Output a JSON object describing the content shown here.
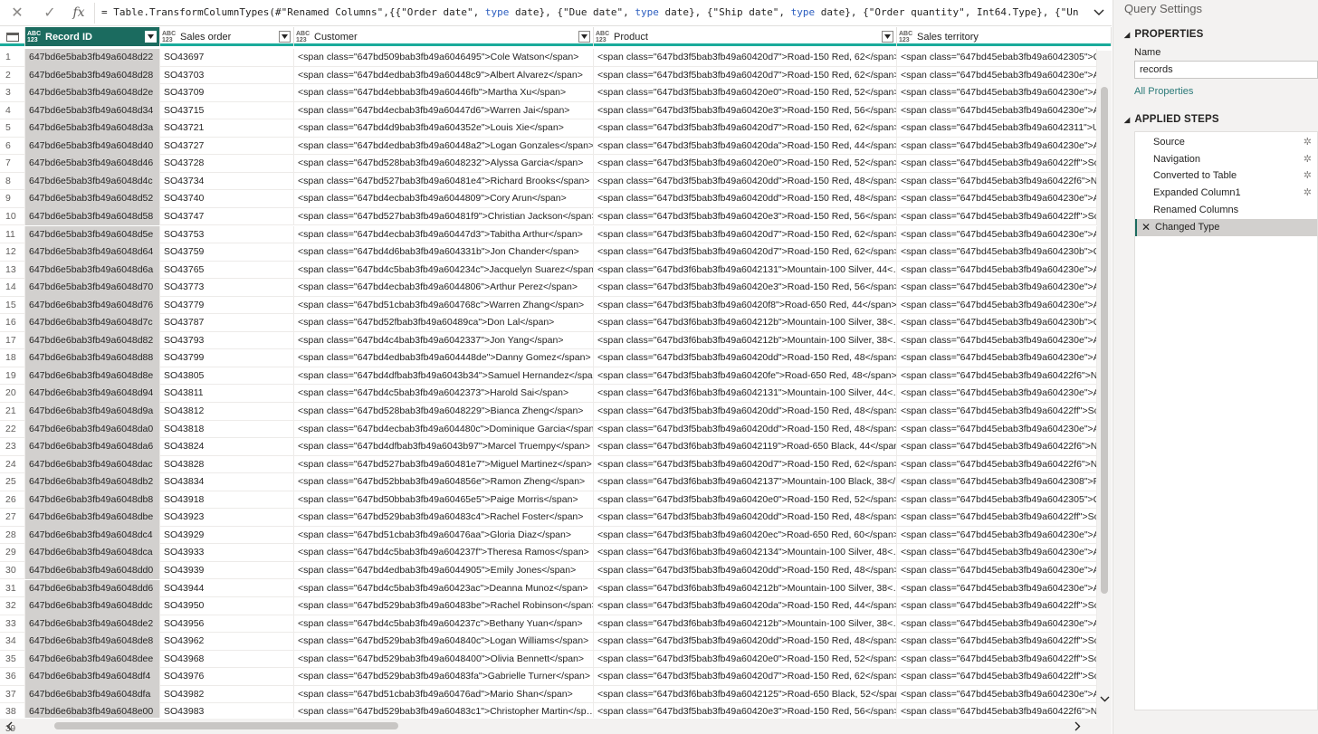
{
  "formula_bar": {
    "cancel_icon": "close-icon",
    "commit_icon": "check-icon",
    "fx_label": "fx",
    "formula_parts": [
      {
        "t": "= Table.TransformColumnTypes(#\"Renamed Columns\",{{\"Order date\", ",
        "kw": false
      },
      {
        "t": "type",
        "kw": true
      },
      {
        "t": " date}, {\"Due date\", ",
        "kw": false
      },
      {
        "t": "type",
        "kw": true
      },
      {
        "t": " date}, {\"Ship date\", ",
        "kw": false
      },
      {
        "t": "type",
        "kw": true
      },
      {
        "t": " date}, {\"Order quantity\", Int64.Type}, {\"Unit price $\",",
        "kw": false
      }
    ]
  },
  "grid": {
    "columns": [
      {
        "type_top": "ABC",
        "type_bottom": "123",
        "label": "Record ID",
        "selected": true
      },
      {
        "type_top": "ABC",
        "type_bottom": "123",
        "label": "Sales order",
        "selected": false
      },
      {
        "type_top": "ABC",
        "type_bottom": "123",
        "label": "Customer",
        "selected": false
      },
      {
        "type_top": "ABC",
        "type_bottom": "123",
        "label": "Product",
        "selected": false
      },
      {
        "type_top": "ABC",
        "type_bottom": "123",
        "label": "Sales territory",
        "selected": false
      }
    ],
    "rows": [
      [
        "1",
        "647bd6e5bab3fb49a6048d22",
        "SO43697",
        "<span class=\"647bd509bab3fb49a6046495\">Cole Watson</span>",
        "<span class=\"647bd3f5bab3fb49a60420d7\">Road-150 Red, 62</span>",
        "<span class=\"647bd45ebab3fb49a6042305\">Ca"
      ],
      [
        "2",
        "647bd6e5bab3fb49a6048d28",
        "SO43703",
        "<span class=\"647bd4edbab3fb49a60448c9\">Albert Alvarez</span>",
        "<span class=\"647bd3f5bab3fb49a60420d7\">Road-150 Red, 62</span>",
        "<span class=\"647bd45ebab3fb49a604230e\">Au"
      ],
      [
        "3",
        "647bd6e5bab3fb49a6048d2e",
        "SO43709",
        "<span class=\"647bd4ebbab3fb49a60446fb\">Martha Xu</span>",
        "<span class=\"647bd3f5bab3fb49a60420e0\">Road-150 Red, 52</span>",
        "<span class=\"647bd45ebab3fb49a604230e\">Au"
      ],
      [
        "4",
        "647bd6e5bab3fb49a6048d34",
        "SO43715",
        "<span class=\"647bd4ecbab3fb49a60447d6\">Warren Jai</span>",
        "<span class=\"647bd3f5bab3fb49a60420e3\">Road-150 Red, 56</span>",
        "<span class=\"647bd45ebab3fb49a604230e\">Au"
      ],
      [
        "5",
        "647bd6e5bab3fb49a6048d3a",
        "SO43721",
        "<span class=\"647bd4d9bab3fb49a604352e\">Louis Xie</span>",
        "<span class=\"647bd3f5bab3fb49a60420d7\">Road-150 Red, 62</span>",
        "<span class=\"647bd45ebab3fb49a6042311\">Ur"
      ],
      [
        "6",
        "647bd6e5bab3fb49a6048d40",
        "SO43727",
        "<span class=\"647bd4edbab3fb49a60448a2\">Logan Gonzales</span>",
        "<span class=\"647bd3f5bab3fb49a60420da\">Road-150 Red, 44</span>",
        "<span class=\"647bd45ebab3fb49a604230e\">Au"
      ],
      [
        "7",
        "647bd6e5bab3fb49a6048d46",
        "SO43728",
        "<span class=\"647bd528bab3fb49a6048232\">Alyssa Garcia</span>",
        "<span class=\"647bd3f5bab3fb49a60420e0\">Road-150 Red, 52</span>",
        "<span class=\"647bd45ebab3fb49a60422ff\">Sou"
      ],
      [
        "8",
        "647bd6e5bab3fb49a6048d4c",
        "SO43734",
        "<span class=\"647bd527bab3fb49a60481e4\">Richard Brooks</span>",
        "<span class=\"647bd3f5bab3fb49a60420dd\">Road-150 Red, 48</span>",
        "<span class=\"647bd45ebab3fb49a60422f6\">No"
      ],
      [
        "9",
        "647bd6e5bab3fb49a6048d52",
        "SO43740",
        "<span class=\"647bd4ecbab3fb49a6044809\">Cory Arun</span>",
        "<span class=\"647bd3f5bab3fb49a60420dd\">Road-150 Red, 48</span>",
        "<span class=\"647bd45ebab3fb49a604230e\">Au"
      ],
      [
        "10",
        "647bd6e5bab3fb49a6048d58",
        "SO43747",
        "<span class=\"647bd527bab3fb49a60481f9\">Christian Jackson</span>",
        "<span class=\"647bd3f5bab3fb49a60420e3\">Road-150 Red, 56</span>",
        "<span class=\"647bd45ebab3fb49a60422ff\">Sou"
      ],
      [
        "11",
        "647bd6e5bab3fb49a6048d5e",
        "SO43753",
        "<span class=\"647bd4ecbab3fb49a60447d3\">Tabitha Arthur</span>",
        "<span class=\"647bd3f5bab3fb49a60420d7\">Road-150 Red, 62</span>",
        "<span class=\"647bd45ebab3fb49a604230e\">Au"
      ],
      [
        "12",
        "647bd6e5bab3fb49a6048d64",
        "SO43759",
        "<span class=\"647bd4d6bab3fb49a604331b\">Jon Chander</span>",
        "<span class=\"647bd3f5bab3fb49a60420d7\">Road-150 Red, 62</span>",
        "<span class=\"647bd45ebab3fb49a604230b\">Ge"
      ],
      [
        "13",
        "647bd6e5bab3fb49a6048d6a",
        "SO43765",
        "<span class=\"647bd4c5bab3fb49a604234c\">Jacquelyn Suarez</span>",
        "<span class=\"647bd3f6bab3fb49a6042131\">Mountain-100 Silver, 44<…",
        "<span class=\"647bd45ebab3fb49a604230e\">Au"
      ],
      [
        "14",
        "647bd6e5bab3fb49a6048d70",
        "SO43773",
        "<span class=\"647bd4ecbab3fb49a6044806\">Arthur Perez</span>",
        "<span class=\"647bd3f5bab3fb49a60420e3\">Road-150 Red, 56</span>",
        "<span class=\"647bd45ebab3fb49a604230e\">Au"
      ],
      [
        "15",
        "647bd6e6bab3fb49a6048d76",
        "SO43779",
        "<span class=\"647bd51cbab3fb49a604768c\">Warren Zhang</span>",
        "<span class=\"647bd3f5bab3fb49a60420f8\">Road-650 Red, 44</span>",
        "<span class=\"647bd45ebab3fb49a604230e\">Au"
      ],
      [
        "16",
        "647bd6e6bab3fb49a6048d7c",
        "SO43787",
        "<span class=\"647bd52fbab3fb49a60489ca\">Don Lal</span>",
        "<span class=\"647bd3f6bab3fb49a604212b\">Mountain-100 Silver, 38<…",
        "<span class=\"647bd45ebab3fb49a604230b\">Ge"
      ],
      [
        "17",
        "647bd6e6bab3fb49a6048d82",
        "SO43793",
        "<span class=\"647bd4c4bab3fb49a6042337\">Jon Yang</span>",
        "<span class=\"647bd3f6bab3fb49a604212b\">Mountain-100 Silver, 38<…",
        "<span class=\"647bd45ebab3fb49a604230e\">Au"
      ],
      [
        "18",
        "647bd6e6bab3fb49a6048d88",
        "SO43799",
        "<span class=\"647bd4edbab3fb49a604448de\">Danny Gomez</span>",
        "<span class=\"647bd3f5bab3fb49a60420dd\">Road-150 Red, 48</span>",
        "<span class=\"647bd45ebab3fb49a604230e\">Au"
      ],
      [
        "19",
        "647bd6e6bab3fb49a6048d8e",
        "SO43805",
        "<span class=\"647bd4dfbab3fb49a6043b34\">Samuel Hernandez</spa…",
        "<span class=\"647bd3f5bab3fb49a60420fe\">Road-650 Red, 48</span>",
        "<span class=\"647bd45ebab3fb49a60422f6\">No"
      ],
      [
        "20",
        "647bd6e6bab3fb49a6048d94",
        "SO43811",
        "<span class=\"647bd4c5bab3fb49a6042373\">Harold Sai</span>",
        "<span class=\"647bd3f6bab3fb49a6042131\">Mountain-100 Silver, 44<…",
        "<span class=\"647bd45ebab3fb49a604230e\">Au"
      ],
      [
        "21",
        "647bd6e6bab3fb49a6048d9a",
        "SO43812",
        "<span class=\"647bd528bab3fb49a6048229\">Bianca Zheng</span>",
        "<span class=\"647bd3f5bab3fb49a60420dd\">Road-150 Red, 48</span>",
        "<span class=\"647bd45ebab3fb49a60422ff\">Sou"
      ],
      [
        "22",
        "647bd6e6bab3fb49a6048da0",
        "SO43818",
        "<span class=\"647bd4ecbab3fb49a604480c\">Dominique Garcia</span>",
        "<span class=\"647bd3f5bab3fb49a60420dd\">Road-150 Red, 48</span>",
        "<span class=\"647bd45ebab3fb49a604230e\">Au"
      ],
      [
        "23",
        "647bd6e6bab3fb49a6048da6",
        "SO43824",
        "<span class=\"647bd4dfbab3fb49a6043b97\">Marcel Truempy</span>",
        "<span class=\"647bd3f6bab3fb49a6042119\">Road-650 Black, 44</span>",
        "<span class=\"647bd45ebab3fb49a60422f6\">No"
      ],
      [
        "24",
        "647bd6e6bab3fb49a6048dac",
        "SO43828",
        "<span class=\"647bd527bab3fb49a60481e7\">Miguel Martinez</span>",
        "<span class=\"647bd3f5bab3fb49a60420d7\">Road-150 Red, 62</span>",
        "<span class=\"647bd45ebab3fb49a60422f6\">No"
      ],
      [
        "25",
        "647bd6e6bab3fb49a6048db2",
        "SO43834",
        "<span class=\"647bd52bbab3fb49a604856e\">Ramon Zheng</span>",
        "<span class=\"647bd3f6bab3fb49a6042137\">Mountain-100 Black, 38</…",
        "<span class=\"647bd45ebab3fb49a6042308\">Fra"
      ],
      [
        "26",
        "647bd6e6bab3fb49a6048db8",
        "SO43918",
        "<span class=\"647bd50bbab3fb49a60465e5\">Paige Morris</span>",
        "<span class=\"647bd3f5bab3fb49a60420e0\">Road-150 Red, 52</span>",
        "<span class=\"647bd45ebab3fb49a6042305\">Ca"
      ],
      [
        "27",
        "647bd6e6bab3fb49a6048dbe",
        "SO43923",
        "<span class=\"647bd529bab3fb49a60483c4\">Rachel Foster</span>",
        "<span class=\"647bd3f5bab3fb49a60420dd\">Road-150 Red, 48</span>",
        "<span class=\"647bd45ebab3fb49a60422ff\">Sou"
      ],
      [
        "28",
        "647bd6e6bab3fb49a6048dc4",
        "SO43929",
        "<span class=\"647bd51cbab3fb49a60476aa\">Gloria Diaz</span>",
        "<span class=\"647bd3f5bab3fb49a60420ec\">Road-650 Red, 60</span>",
        "<span class=\"647bd45ebab3fb49a604230e\">Au"
      ],
      [
        "29",
        "647bd6e6bab3fb49a6048dca",
        "SO43933",
        "<span class=\"647bd4c5bab3fb49a604237f\">Theresa Ramos</span>",
        "<span class=\"647bd3f6bab3fb49a6042134\">Mountain-100 Silver, 48<…",
        "<span class=\"647bd45ebab3fb49a604230e\">Au"
      ],
      [
        "30",
        "647bd6e6bab3fb49a6048dd0",
        "SO43939",
        "<span class=\"647bd4edbab3fb49a6044905\">Emily Jones</span>",
        "<span class=\"647bd3f5bab3fb49a60420dd\">Road-150 Red, 48</span>",
        "<span class=\"647bd45ebab3fb49a604230e\">Au"
      ],
      [
        "31",
        "647bd6e6bab3fb49a6048dd6",
        "SO43944",
        "<span class=\"647bd4c5bab3fb49a60423ac\">Deanna Munoz</span>",
        "<span class=\"647bd3f6bab3fb49a604212b\">Mountain-100 Silver, 38<…",
        "<span class=\"647bd45ebab3fb49a604230e\">Au"
      ],
      [
        "32",
        "647bd6e6bab3fb49a6048ddc",
        "SO43950",
        "<span class=\"647bd529bab3fb49a60483be\">Rachel Robinson</span>",
        "<span class=\"647bd3f5bab3fb49a60420da\">Road-150 Red, 44</span>",
        "<span class=\"647bd45ebab3fb49a60422ff\">Sou"
      ],
      [
        "33",
        "647bd6e6bab3fb49a6048de2",
        "SO43956",
        "<span class=\"647bd4c5bab3fb49a604237c\">Bethany Yuan</span>",
        "<span class=\"647bd3f6bab3fb49a604212b\">Mountain-100 Silver, 38<…",
        "<span class=\"647bd45ebab3fb49a604230e\">Au"
      ],
      [
        "34",
        "647bd6e6bab3fb49a6048de8",
        "SO43962",
        "<span class=\"647bd529bab3fb49a604840c\">Logan Williams</span>",
        "<span class=\"647bd3f5bab3fb49a60420dd\">Road-150 Red, 48</span>",
        "<span class=\"647bd45ebab3fb49a60422ff\">Sou"
      ],
      [
        "35",
        "647bd6e6bab3fb49a6048dee",
        "SO43968",
        "<span class=\"647bd529bab3fb49a6048400\">Olivia Bennett</span>",
        "<span class=\"647bd3f5bab3fb49a60420e0\">Road-150 Red, 52</span>",
        "<span class=\"647bd45ebab3fb49a60422ff\">Sou"
      ],
      [
        "36",
        "647bd6e6bab3fb49a6048df4",
        "SO43976",
        "<span class=\"647bd529bab3fb49a60483fa\">Gabrielle Turner</span>",
        "<span class=\"647bd3f5bab3fb49a60420d7\">Road-150 Red, 62</span>",
        "<span class=\"647bd45ebab3fb49a60422ff\">Sou"
      ],
      [
        "37",
        "647bd6e6bab3fb49a6048dfa",
        "SO43982",
        "<span class=\"647bd51cbab3fb49a60476ad\">Mario Shan</span>",
        "<span class=\"647bd3f6bab3fb49a6042125\">Road-650 Black, 52</span>",
        "<span class=\"647bd45ebab3fb49a604230e\">Au"
      ],
      [
        "38",
        "647bd6e6bab3fb49a6048e00",
        "SO43983",
        "<span class=\"647bd529bab3fb49a60483c1\">Christopher Martin</sp…",
        "<span class=\"647bd3f5bab3fb49a60420e3\">Road-150 Red, 56</span>",
        "<span class=\"647bd45ebab3fb49a60422f6\">No"
      ]
    ],
    "partial_row_number": "39"
  },
  "query_settings": {
    "title": "Query Settings",
    "properties_heading": "PROPERTIES",
    "name_label": "Name",
    "name_value": "records",
    "all_properties_link": "All Properties",
    "applied_steps_heading": "APPLIED STEPS",
    "steps": [
      {
        "label": "Source",
        "has_gear": true,
        "active": false
      },
      {
        "label": "Navigation",
        "has_gear": true,
        "active": false
      },
      {
        "label": "Converted to Table",
        "has_gear": true,
        "active": false
      },
      {
        "label": "Expanded Column1",
        "has_gear": true,
        "active": false
      },
      {
        "label": "Renamed Columns",
        "has_gear": false,
        "active": false
      },
      {
        "label": "Changed Type",
        "has_gear": false,
        "active": true
      }
    ],
    "accent_color": "#1b6b5f",
    "header_underline_color": "#1aab9b"
  }
}
